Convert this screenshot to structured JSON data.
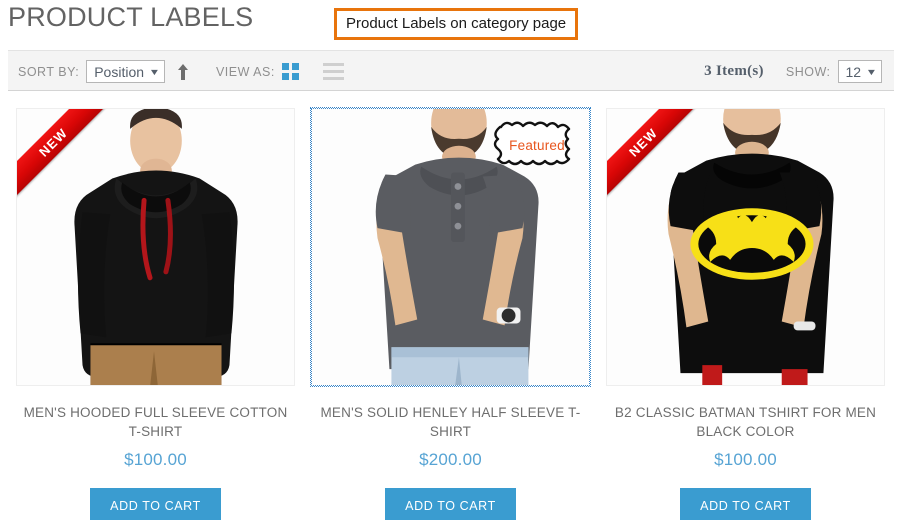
{
  "header": {
    "title": "PRODUCT LABELS",
    "annotation": "Product Labels on category page"
  },
  "toolbar": {
    "sort_by_label": "SORT BY:",
    "sort_by_value": "Position",
    "sort_direction_icon": "arrow-up-icon",
    "view_as_label": "VIEW AS:",
    "view_grid_icon": "grid-view-icon",
    "view_list_icon": "list-view-icon",
    "item_count": "3 Item(s)",
    "show_label": "SHOW:",
    "show_value": "12"
  },
  "products": [
    {
      "name": "MEN'S HOODED FULL SLEEVE COTTON T-SHIRT",
      "price": "$100.00",
      "label": "NEW",
      "label_type": "ribbon-new",
      "add_to_cart": "ADD TO CART",
      "selected": false
    },
    {
      "name": "MEN'S SOLID HENLEY HALF SLEEVE T-SHIRT",
      "price": "$200.00",
      "label": "Featured",
      "label_type": "plaque-featured",
      "add_to_cart": "ADD TO CART",
      "selected": true
    },
    {
      "name": "B2 CLASSIC BATMAN TSHIRT FOR MEN BLACK COLOR",
      "price": "$100.00",
      "label": "NEW",
      "label_type": "ribbon-new",
      "add_to_cart": "ADD TO CART",
      "selected": false
    }
  ],
  "colors": {
    "accent_blue": "#3a9cd0",
    "price_blue": "#57a4d4",
    "ribbon_red": "#d90606",
    "annotation_orange": "#e8740c",
    "featured_orange": "#e8561f",
    "toolbar_bg": "#f4f4f4",
    "title_gray": "#636363"
  }
}
